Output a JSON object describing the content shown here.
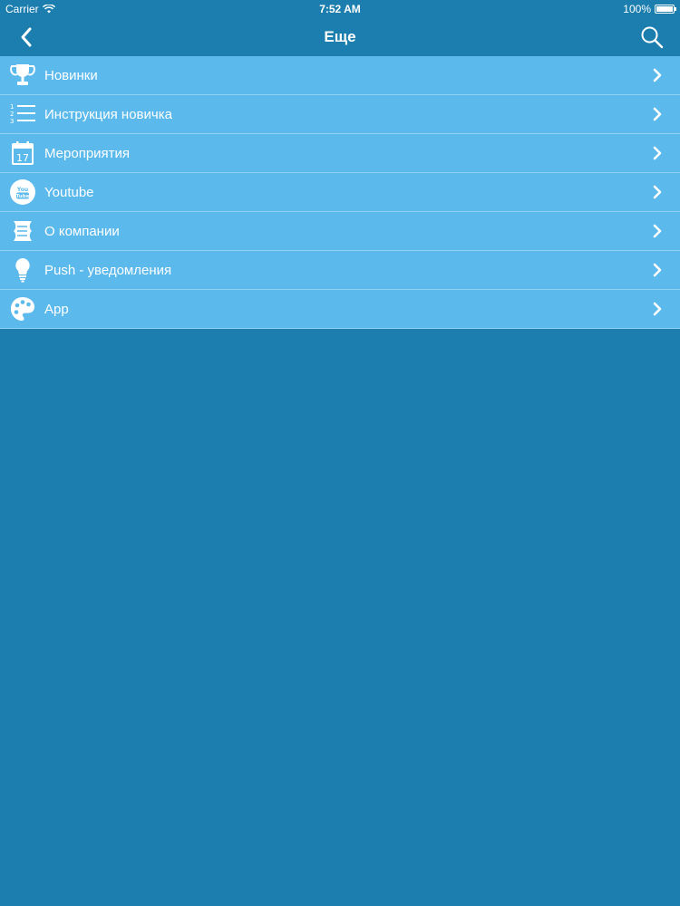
{
  "status_bar": {
    "carrier": "Carrier",
    "time": "7:52 AM",
    "battery": "100%"
  },
  "nav": {
    "title": "Еще",
    "back_icon": "chevron-left-icon",
    "search_icon": "search-icon"
  },
  "menu": {
    "items": [
      {
        "label": "Новинки",
        "icon": "trophy-icon"
      },
      {
        "label": "Инструкция новичка",
        "icon": "numbered-list-icon"
      },
      {
        "label": "Мероприятия",
        "icon": "calendar-icon",
        "icon_text": "17"
      },
      {
        "label": "Youtube",
        "icon": "youtube-icon",
        "icon_text": "You Tube"
      },
      {
        "label": "О компании",
        "icon": "scroll-icon"
      },
      {
        "label": "Push - уведомления",
        "icon": "lightbulb-icon"
      },
      {
        "label": "App",
        "icon": "palette-icon"
      }
    ]
  },
  "colors": {
    "background": "#1b7eae",
    "row": "#5bb9ec",
    "divider": "#8fd0f3",
    "text": "#ffffff"
  }
}
